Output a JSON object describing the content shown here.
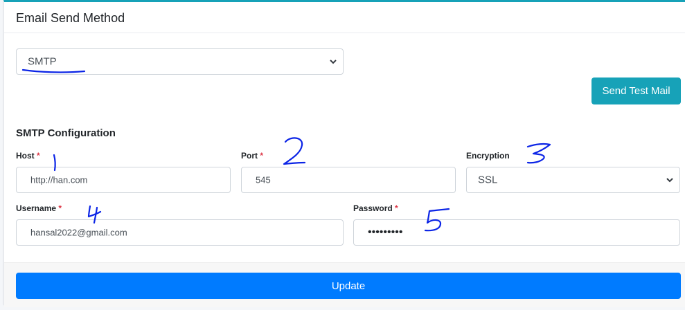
{
  "card": {
    "title": "Email Send Method"
  },
  "method_select": {
    "value": "SMTP"
  },
  "send_test_button": {
    "label": "Send Test Mail"
  },
  "smtp": {
    "section_title": "SMTP Configuration",
    "host": {
      "label": "Host",
      "value": "http://han.com"
    },
    "port": {
      "label": "Port",
      "value": "545"
    },
    "encryption": {
      "label": "Encryption",
      "value": "SSL"
    },
    "username": {
      "label": "Username",
      "value": "hansal2022@gmail.com"
    },
    "password": {
      "label": "Password",
      "masked": "•••••••••"
    },
    "required_marker": "*"
  },
  "annotations": [
    "1",
    "2",
    "3",
    "4",
    "5"
  ],
  "update_button": {
    "label": "Update"
  },
  "colors": {
    "accent_top": "#17a2b8",
    "primary": "#007bff",
    "info": "#17a2b8",
    "required": "#dc3545",
    "ink": "#0b24e6"
  }
}
